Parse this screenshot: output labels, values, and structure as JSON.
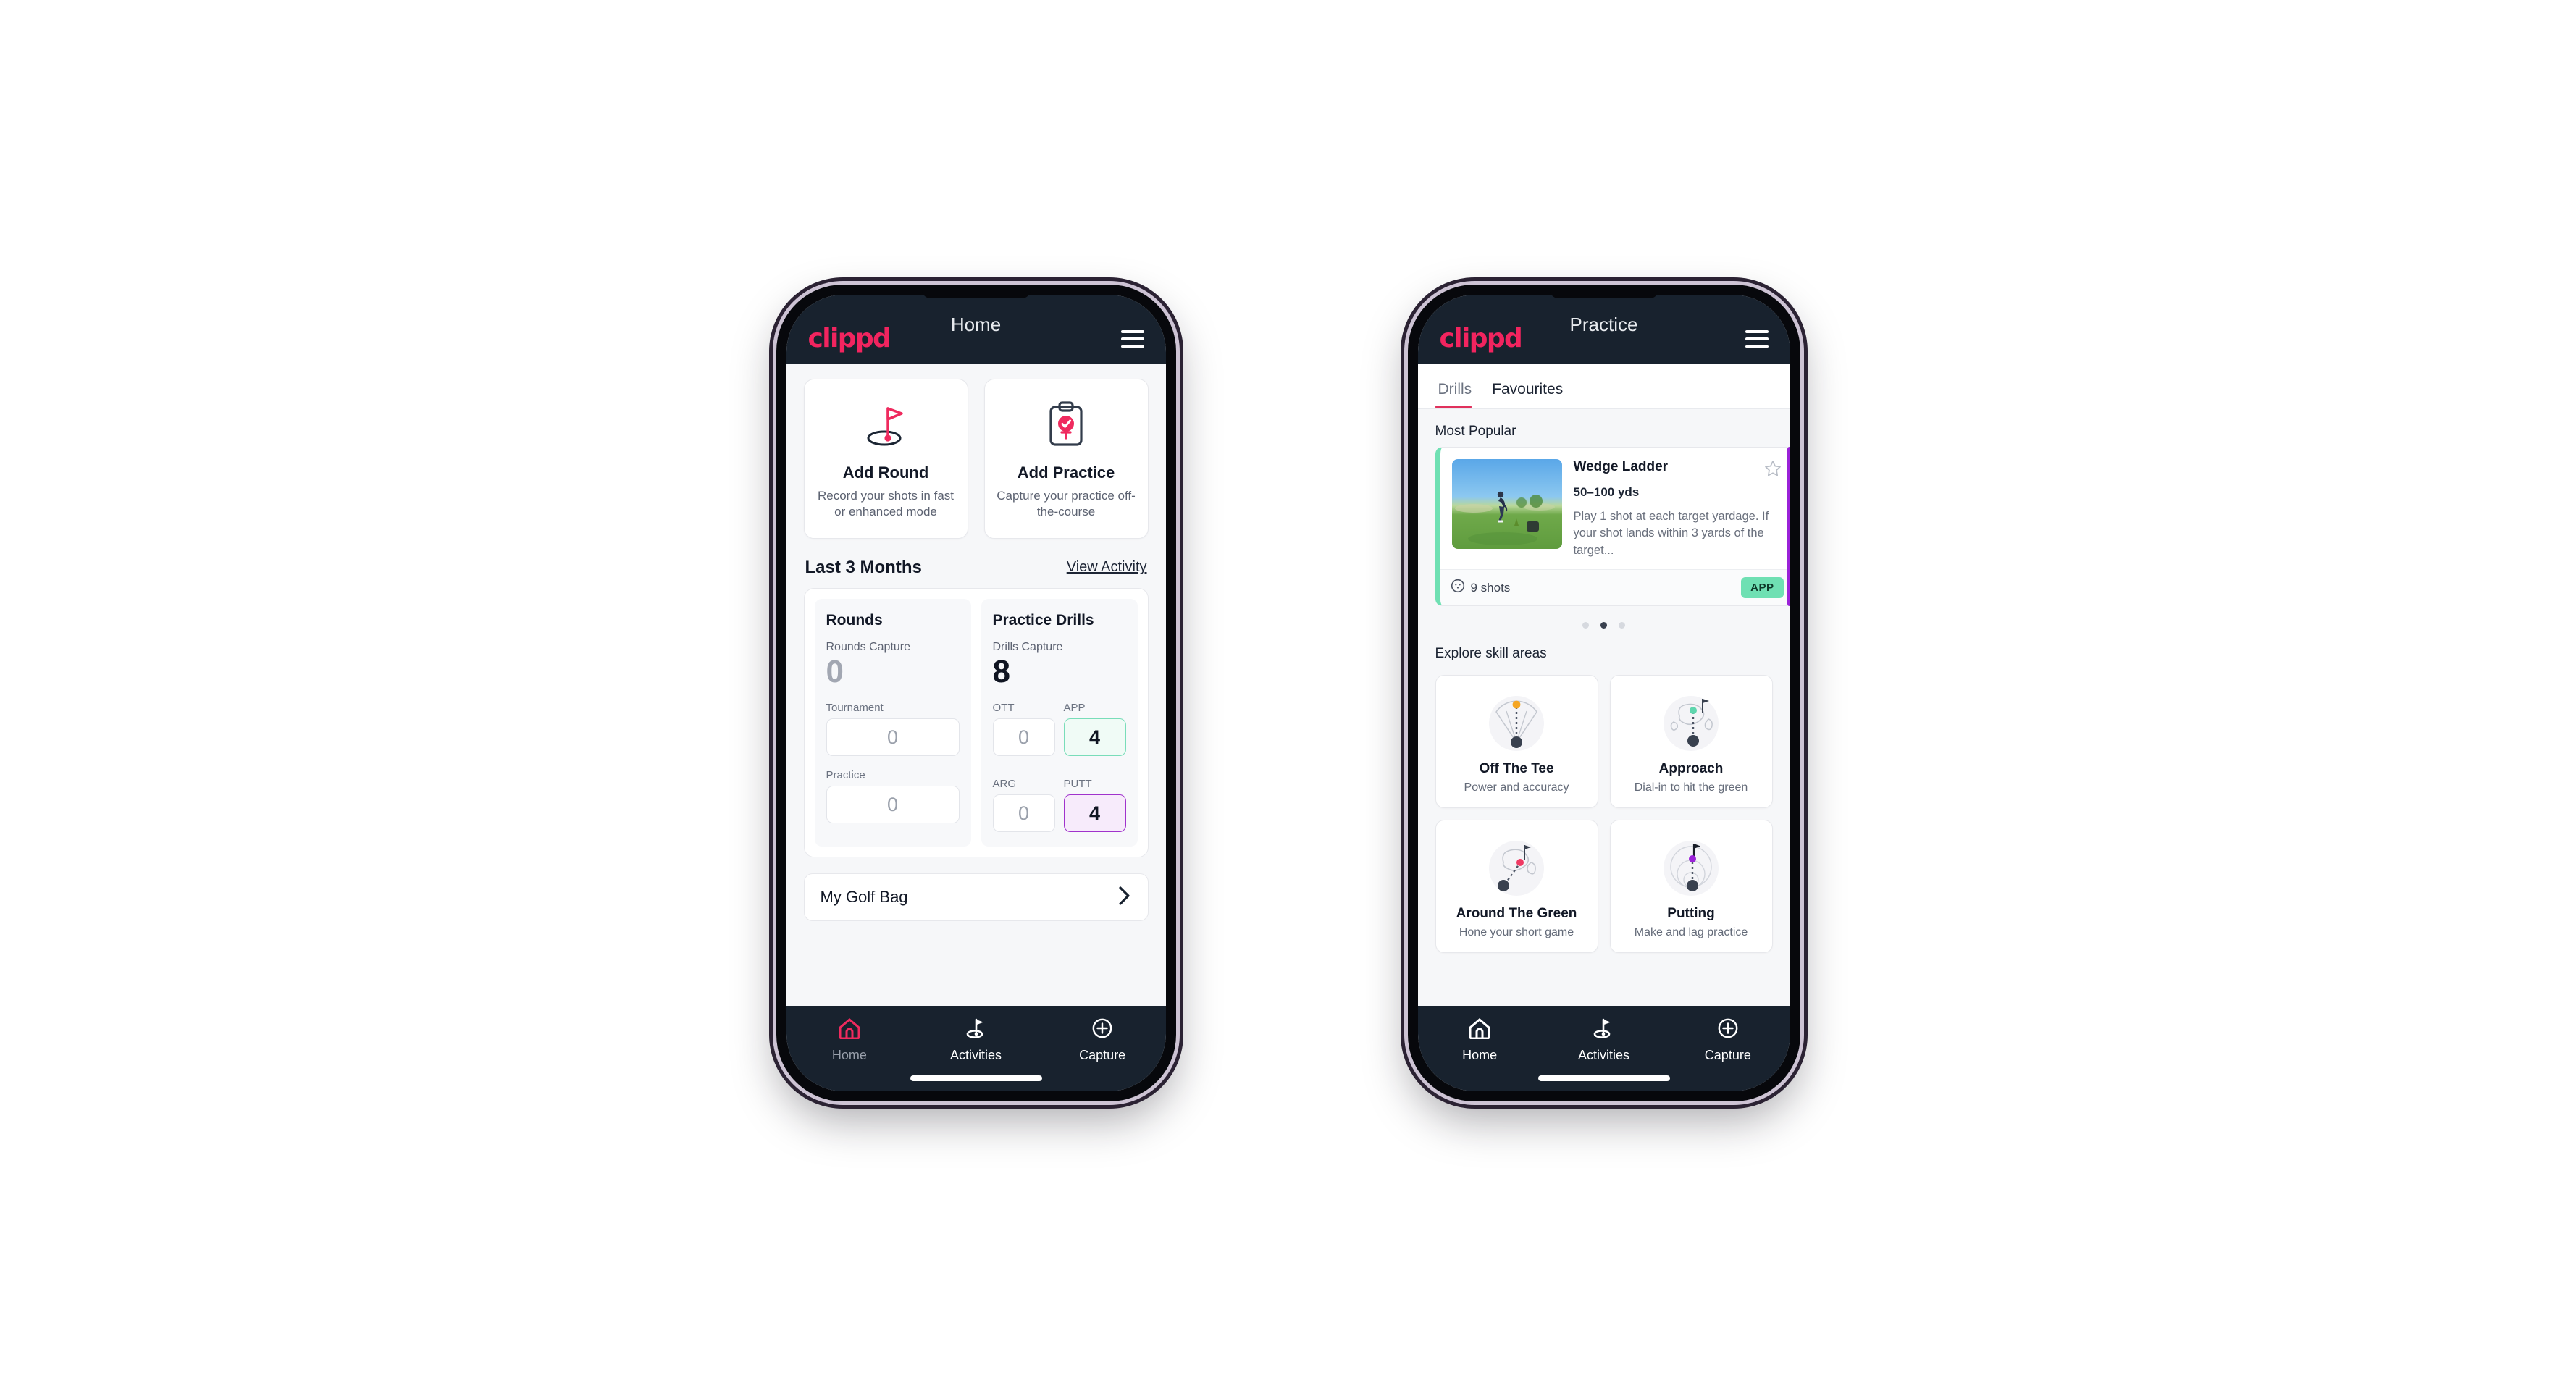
{
  "brand": {
    "logo_text": "clippd",
    "accent": "#f2245f",
    "appbar_bg": "#18222e"
  },
  "home_phone": {
    "appbar": {
      "title": "Home",
      "menu_icon": "hamburger-icon"
    },
    "actions": [
      {
        "icon": "golf-flag-icon",
        "title": "Add Round",
        "subtitle": "Record your shots in fast or enhanced mode"
      },
      {
        "icon": "clipboard-check-icon",
        "title": "Add Practice",
        "subtitle": "Capture your practice off-the-course"
      }
    ],
    "section": {
      "title": "Last 3 Months",
      "link": "View Activity"
    },
    "stats": {
      "rounds": {
        "heading": "Rounds",
        "capture_label": "Rounds Capture",
        "capture_value": "0",
        "items": [
          {
            "label": "Tournament",
            "value": "0",
            "state": "default"
          },
          {
            "label": "Practice",
            "value": "0",
            "state": "default"
          }
        ]
      },
      "drills": {
        "heading": "Practice Drills",
        "capture_label": "Drills Capture",
        "capture_value": "8",
        "items": [
          {
            "label": "OTT",
            "value": "0",
            "state": "default"
          },
          {
            "label": "APP",
            "value": "4",
            "state": "app"
          },
          {
            "label": "ARG",
            "value": "0",
            "state": "default"
          },
          {
            "label": "PUTT",
            "value": "4",
            "state": "putt"
          }
        ]
      }
    },
    "golf_bag": {
      "label": "My Golf Bag",
      "chevron": "chevron-right-icon"
    },
    "nav": [
      {
        "icon": "home-icon",
        "label": "Home",
        "active": true
      },
      {
        "icon": "golf-flag-icon",
        "label": "Activities",
        "active": false
      },
      {
        "icon": "plus-circle-icon",
        "label": "Capture",
        "active": false
      }
    ]
  },
  "practice_phone": {
    "appbar": {
      "title": "Practice",
      "menu_icon": "hamburger-icon"
    },
    "tabs": [
      {
        "label": "Drills",
        "active": true
      },
      {
        "label": "Favourites",
        "active": false
      }
    ],
    "most_popular_label": "Most Popular",
    "drill": {
      "title": "Wedge Ladder",
      "yardage": "50–100 yds",
      "description": "Play 1 shot at each target yardage. If your shot lands within 3 yards of the target...",
      "shots": "9 shots",
      "shots_icon": "golf-ball-icon",
      "badge": "APP",
      "badge_color": "#6fe0b3",
      "accent_color": "#6fe0b3",
      "next_card_accent": "#9a22d8",
      "favourite_icon": "star-outline-icon",
      "thumbnail": "golfer-wedge-shot-photo"
    },
    "carousel_dots": {
      "count": 3,
      "active_index": 1
    },
    "skills_label": "Explore skill areas",
    "skills": [
      {
        "icon": "tee-dispersion-icon",
        "name": "Off The Tee",
        "sub": "Power and accuracy",
        "dot_color": "#f5a623"
      },
      {
        "icon": "green-approach-icon",
        "name": "Approach",
        "sub": "Dial-in to hit the green",
        "dot_color": "#5fd6ae"
      },
      {
        "icon": "chip-around-green-icon",
        "name": "Around The Green",
        "sub": "Hone your short game",
        "dot_color": "#ef3a63"
      },
      {
        "icon": "putting-rings-icon",
        "name": "Putting",
        "sub": "Make and lag practice",
        "dot_color": "#9a22d8"
      }
    ],
    "nav": [
      {
        "icon": "home-icon",
        "label": "Home",
        "active": false
      },
      {
        "icon": "golf-flag-icon",
        "label": "Activities",
        "active": true
      },
      {
        "icon": "plus-circle-icon",
        "label": "Capture",
        "active": false
      }
    ]
  }
}
